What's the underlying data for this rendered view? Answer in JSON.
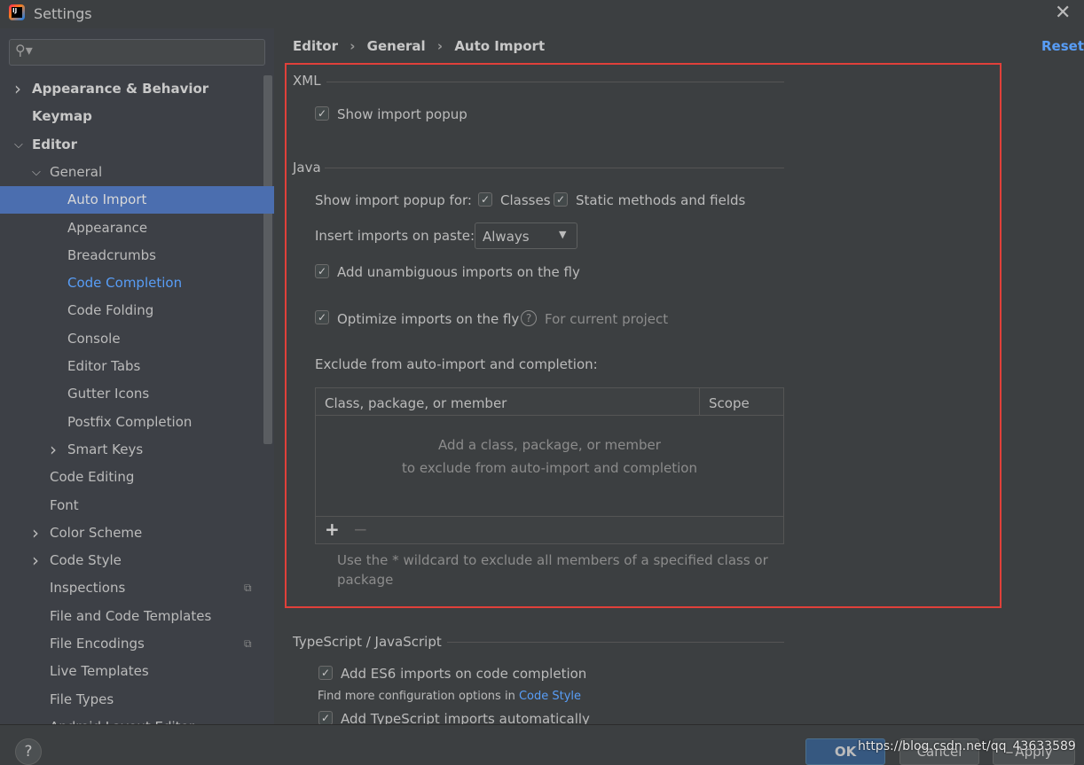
{
  "window": {
    "title": "Settings",
    "close_icon": "close-icon",
    "app_icon": "intellij-idea-icon"
  },
  "search": {
    "placeholder": "",
    "icon": "search-icon"
  },
  "sidebar": {
    "items": [
      {
        "label": "Appearance & Behavior",
        "level": 0,
        "expandable": true,
        "bold": true
      },
      {
        "label": "Keymap",
        "level": 0,
        "bold": true
      },
      {
        "label": "Editor",
        "level": 0,
        "expanded": true,
        "bold": true
      },
      {
        "label": "General",
        "level": 1,
        "expanded": true
      },
      {
        "label": "Auto Import",
        "level": 2,
        "selected": true
      },
      {
        "label": "Appearance",
        "level": 2
      },
      {
        "label": "Breadcrumbs",
        "level": 2
      },
      {
        "label": "Code Completion",
        "level": 2,
        "modified": true
      },
      {
        "label": "Code Folding",
        "level": 2
      },
      {
        "label": "Console",
        "level": 2
      },
      {
        "label": "Editor Tabs",
        "level": 2
      },
      {
        "label": "Gutter Icons",
        "level": 2
      },
      {
        "label": "Postfix Completion",
        "level": 2
      },
      {
        "label": "Smart Keys",
        "level": 2,
        "expandable": true
      },
      {
        "label": "Code Editing",
        "level": 1
      },
      {
        "label": "Font",
        "level": 1
      },
      {
        "label": "Color Scheme",
        "level": 1,
        "expandable": true
      },
      {
        "label": "Code Style",
        "level": 1,
        "expandable": true
      },
      {
        "label": "Inspections",
        "level": 1,
        "project_icon": true
      },
      {
        "label": "File and Code Templates",
        "level": 1
      },
      {
        "label": "File Encodings",
        "level": 1,
        "project_icon": true
      },
      {
        "label": "Live Templates",
        "level": 1
      },
      {
        "label": "File Types",
        "level": 1
      },
      {
        "label": "Android Layout Editor",
        "level": 1
      }
    ]
  },
  "breadcrumb": [
    "Editor",
    "General",
    "Auto Import"
  ],
  "reset_label": "Reset",
  "xml": {
    "title": "XML",
    "show_popup": "Show import popup"
  },
  "java": {
    "title": "Java",
    "popup_for": "Show import popup for:",
    "classes": "Classes",
    "static": "Static methods and fields",
    "insert_label": "Insert imports on paste:",
    "insert_value": "Always",
    "unambiguous": "Add unambiguous imports on the fly",
    "optimize": "Optimize imports on the fly",
    "for_project": "For current project",
    "exclude_title": "Exclude from auto-import and completion:",
    "col_member": "Class, package, or member",
    "col_scope": "Scope",
    "empty1": "Add a class, package, or member",
    "empty2": "to exclude from auto-import and completion",
    "add": "+",
    "remove": "−",
    "hint1": "Use the * wildcard to exclude all members of a specified class or",
    "hint2": "package"
  },
  "ts": {
    "title": "TypeScript / JavaScript",
    "es6": "Add ES6 imports on code completion",
    "more": "Find more configuration options in",
    "code_style": "Code Style",
    "auto": "Add TypeScript imports automatically"
  },
  "footer": {
    "help": "?",
    "ok": "OK",
    "cancel": "Cancel",
    "apply": "Apply",
    "watermark": "https://blog.csdn.net/qq_43633589"
  },
  "colors": {
    "accent": "#589df6",
    "selection": "#4b6eaf",
    "highlight_box": "#e0403a"
  }
}
